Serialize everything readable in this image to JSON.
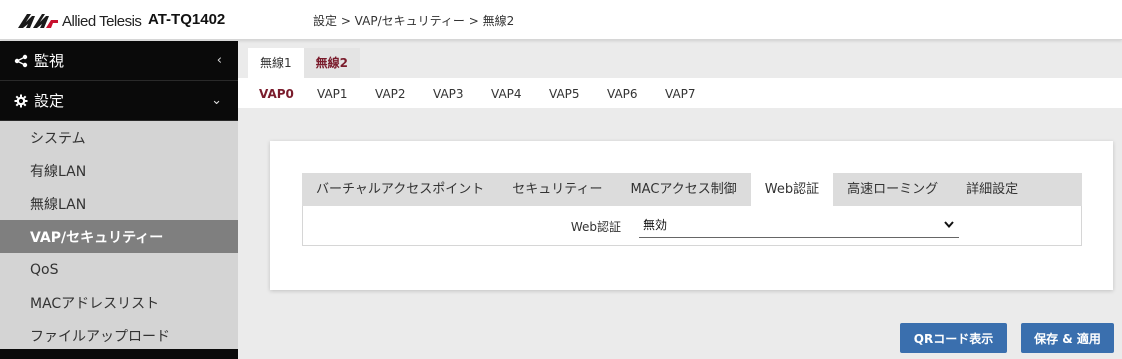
{
  "header": {
    "brand": "Allied Telesis",
    "model": "AT-TQ1402",
    "breadcrumb": "設定 > VAP/セキュリティー > 無線2"
  },
  "sidebar": {
    "monitor": {
      "label": "監視",
      "icon": "share-icon",
      "chevron": "‹"
    },
    "settings": {
      "label": "設定",
      "icon": "gear-icon",
      "chevron": "⌄"
    },
    "items": [
      {
        "label": "システム",
        "active": false
      },
      {
        "label": "有線LAN",
        "active": false
      },
      {
        "label": "無線LAN",
        "active": false
      },
      {
        "label": "VAP/セキュリティー",
        "active": true
      },
      {
        "label": "QoS",
        "active": false
      },
      {
        "label": "MACアドレスリスト",
        "active": false
      },
      {
        "label": "ファイルアップロード",
        "active": false
      }
    ]
  },
  "radio_tabs": [
    {
      "label": "無線1",
      "active": false
    },
    {
      "label": "無線2",
      "active": true
    }
  ],
  "vap_tabs": [
    {
      "label": "VAP0",
      "active": true
    },
    {
      "label": "VAP1",
      "active": false
    },
    {
      "label": "VAP2",
      "active": false
    },
    {
      "label": "VAP3",
      "active": false
    },
    {
      "label": "VAP4",
      "active": false
    },
    {
      "label": "VAP5",
      "active": false
    },
    {
      "label": "VAP6",
      "active": false
    },
    {
      "label": "VAP7",
      "active": false
    }
  ],
  "sub_tabs": [
    {
      "label": "バーチャルアクセスポイント",
      "active": false
    },
    {
      "label": "セキュリティー",
      "active": false
    },
    {
      "label": "MACアクセス制御",
      "active": false
    },
    {
      "label": "Web認証",
      "active": true
    },
    {
      "label": "高速ローミング",
      "active": false
    },
    {
      "label": "詳細設定",
      "active": false
    }
  ],
  "web_auth": {
    "label": "Web認証",
    "value": "無効"
  },
  "buttons": {
    "qr": "QRコード表示",
    "save": "保存 & 適用"
  },
  "colors": {
    "accent": "#7a1c2c",
    "button": "#3a6fae",
    "sidebar_dark": "#0a0a0a",
    "sidebar_active": "#7f7f7f"
  }
}
